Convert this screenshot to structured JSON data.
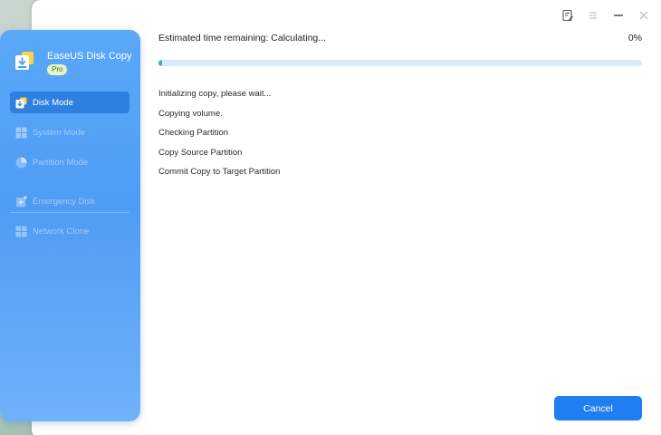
{
  "app": {
    "name": "EaseUS Disk Copy",
    "edition": "Pro"
  },
  "titlebar": {
    "icons": [
      "feedback-icon",
      "menu-icon",
      "minimize-icon",
      "close-icon"
    ]
  },
  "sidebar": {
    "items": [
      {
        "label": "Disk Mode",
        "icon": "disk-mode-icon",
        "active": true
      },
      {
        "label": "System Mode",
        "icon": "system-mode-icon",
        "active": false
      },
      {
        "label": "Partition Mode",
        "icon": "partition-mode-icon",
        "active": false
      },
      {
        "label": "Emergency Disk",
        "icon": "emergency-disk-icon",
        "active": false
      },
      {
        "label": "Network Clone",
        "icon": "network-clone-icon",
        "active": false
      }
    ]
  },
  "progress": {
    "label": "Estimated time remaining:  Calculating...",
    "percent_text": "0%",
    "fraction": 0.0
  },
  "log": [
    "Initializing copy, please wait...",
    "Copying volume.",
    "Checking Partition",
    "Copy Source Partition",
    "Commit Copy to Target Partition"
  ],
  "buttons": {
    "cancel": "Cancel"
  },
  "colors": {
    "accent": "#1f7ef0",
    "sidebar": "#4f9cf5",
    "progress_track": "#d9ebfb"
  }
}
